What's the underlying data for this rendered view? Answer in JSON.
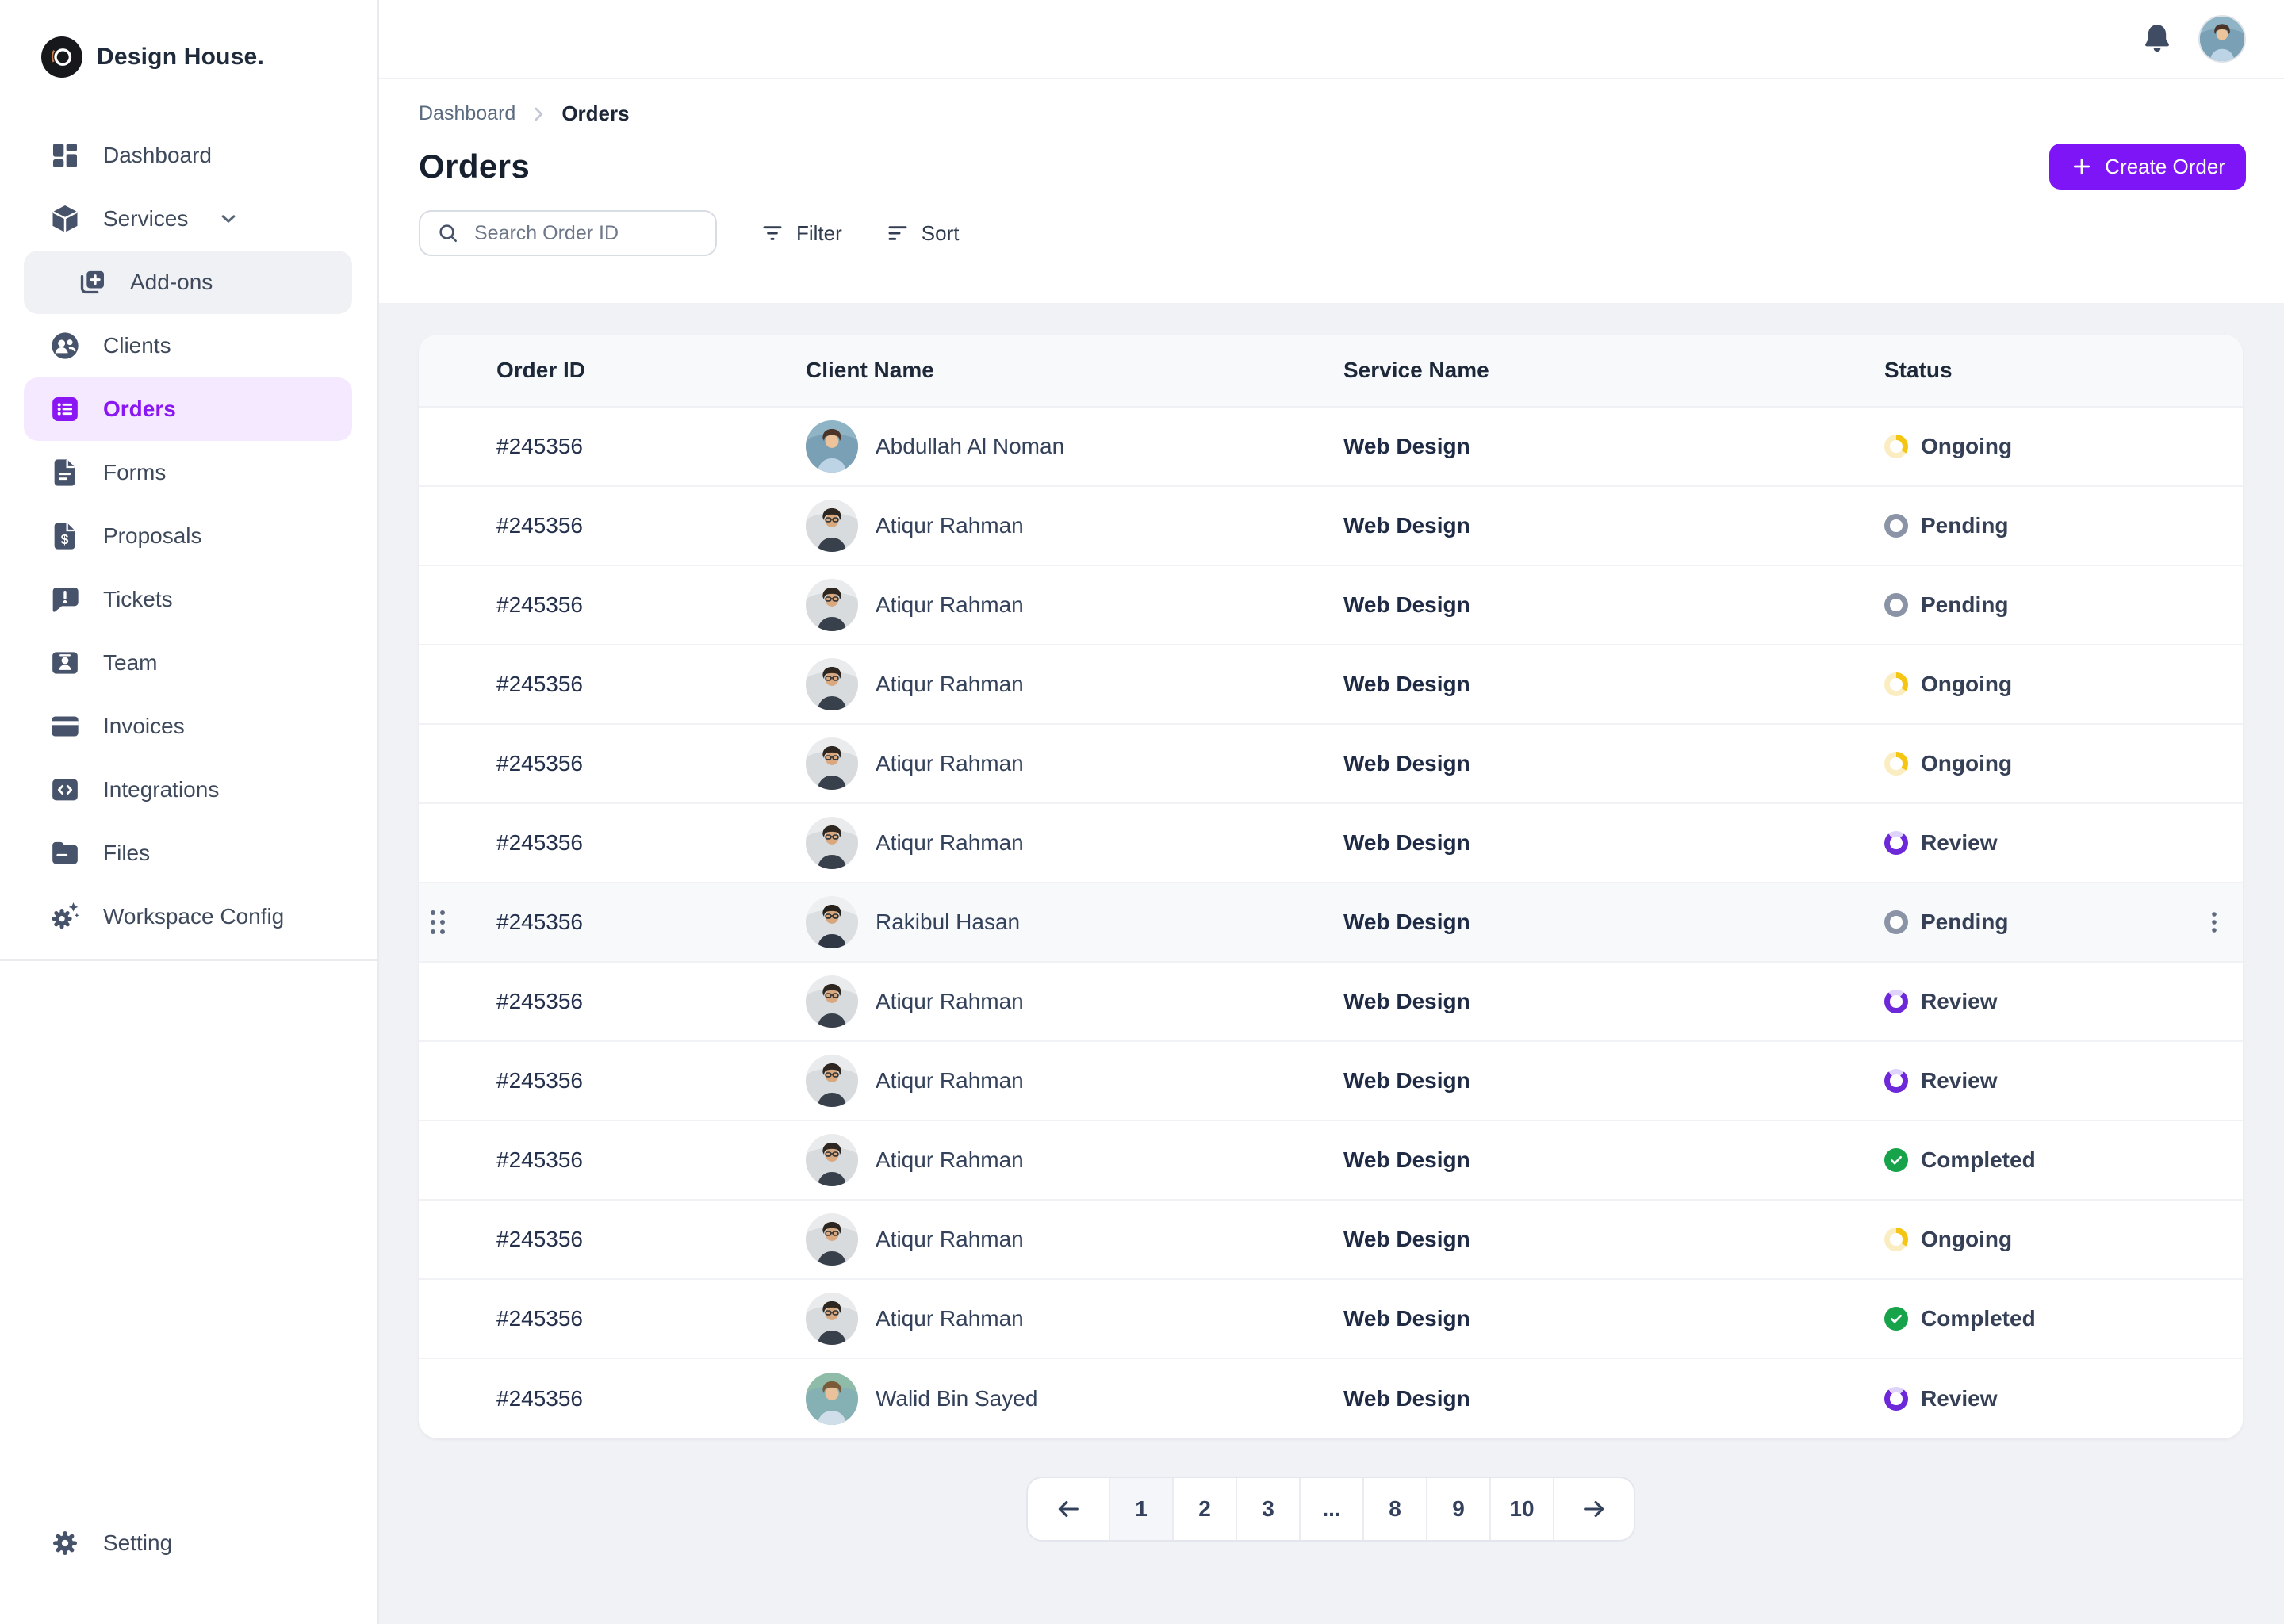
{
  "brand": {
    "name": "Design House.",
    "logo_icon": "brand-logo-icon"
  },
  "accent_color": "#8A16F3",
  "sidebar": {
    "items": [
      {
        "label": "Dashboard",
        "icon": "dashboard-icon"
      },
      {
        "label": "Services",
        "icon": "services-box-icon",
        "chevron": true
      },
      {
        "label": "Add-ons",
        "icon": "copy-plus-icon",
        "sub": true
      },
      {
        "label": "Clients",
        "icon": "clients-users-icon"
      },
      {
        "label": "Orders",
        "icon": "orders-list-icon",
        "active": true
      },
      {
        "label": "Forms",
        "icon": "forms-file-icon"
      },
      {
        "label": "Proposals",
        "icon": "proposals-file-dollar-icon"
      },
      {
        "label": "Tickets",
        "icon": "tickets-chat-alert-icon"
      },
      {
        "label": "Team",
        "icon": "team-id-card-icon"
      },
      {
        "label": "Invoices",
        "icon": "invoices-credit-card-icon"
      },
      {
        "label": "Integrations",
        "icon": "integrations-code-icon"
      },
      {
        "label": "Files",
        "icon": "files-folder-icon"
      },
      {
        "label": "Workspace Config",
        "icon": "workspace-config-gear-sparkle-icon"
      }
    ],
    "footer": {
      "label": "Setting",
      "icon": "gear-icon"
    }
  },
  "topbar": {
    "icons": [
      "bell-icon",
      "user-avatar"
    ]
  },
  "breadcrumb": {
    "parent": "Dashboard",
    "current": "Orders"
  },
  "page": {
    "title": "Orders",
    "create_button": "Create Order"
  },
  "toolbar": {
    "search_placeholder": "Search Order ID",
    "filter_label": "Filter",
    "sort_label": "Sort"
  },
  "table": {
    "columns": [
      "Order ID",
      "Client Name",
      "Service Name",
      "Status"
    ],
    "rows": [
      {
        "order_id": "#245356",
        "client": "Abdullah Al Noman",
        "avatar": "abdullah",
        "service": "Web Design",
        "status": "Ongoing"
      },
      {
        "order_id": "#245356",
        "client": "Atiqur Rahman",
        "avatar": "atiqur",
        "service": "Web Design",
        "status": "Pending"
      },
      {
        "order_id": "#245356",
        "client": "Atiqur Rahman",
        "avatar": "atiqur",
        "service": "Web Design",
        "status": "Pending"
      },
      {
        "order_id": "#245356",
        "client": "Atiqur Rahman",
        "avatar": "atiqur",
        "service": "Web Design",
        "status": "Ongoing"
      },
      {
        "order_id": "#245356",
        "client": "Atiqur Rahman",
        "avatar": "atiqur",
        "service": "Web Design",
        "status": "Ongoing"
      },
      {
        "order_id": "#245356",
        "client": "Atiqur Rahman",
        "avatar": "atiqur",
        "service": "Web Design",
        "status": "Review"
      },
      {
        "order_id": "#245356",
        "client": "Rakibul Hasan",
        "avatar": "rakibul",
        "service": "Web Design",
        "status": "Pending",
        "highlighted": true
      },
      {
        "order_id": "#245356",
        "client": "Atiqur Rahman",
        "avatar": "atiqur",
        "service": "Web Design",
        "status": "Review"
      },
      {
        "order_id": "#245356",
        "client": "Atiqur Rahman",
        "avatar": "atiqur",
        "service": "Web Design",
        "status": "Review"
      },
      {
        "order_id": "#245356",
        "client": "Atiqur Rahman",
        "avatar": "atiqur",
        "service": "Web Design",
        "status": "Completed"
      },
      {
        "order_id": "#245356",
        "client": "Atiqur Rahman",
        "avatar": "atiqur",
        "service": "Web Design",
        "status": "Ongoing"
      },
      {
        "order_id": "#245356",
        "client": "Atiqur Rahman",
        "avatar": "atiqur",
        "service": "Web Design",
        "status": "Completed"
      },
      {
        "order_id": "#245356",
        "client": "Walid Bin Sayed",
        "avatar": "walid",
        "service": "Web Design",
        "status": "Review"
      }
    ]
  },
  "status_colors": {
    "Ongoing": {
      "arc": "#F4C513",
      "track": "#FBEDC2"
    },
    "Pending": {
      "arc": "#8A94A6",
      "track": "#8A94A6"
    },
    "Review": {
      "arc": "#6D28D9",
      "track": "#DFD3FB"
    },
    "Completed": {
      "fill": "#17A34A"
    }
  },
  "avatar_colors": {
    "abdullah": {
      "bg1": "#8FB4C6",
      "bg2": "#678FA6",
      "hair": "#4A3528",
      "skin": "#ECC39B",
      "shirt": "#BCD4E6"
    },
    "atiqur": {
      "bg1": "#E9EBEC",
      "bg2": "#C9CDD1",
      "hair": "#2E2620",
      "skin": "#D9A87E",
      "shirt": "#38404C",
      "glasses": "#3A3A3A"
    },
    "rakibul": {
      "bg1": "#EDEFF0",
      "bg2": "#CDD2D6",
      "hair": "#27211C",
      "skin": "#D6A77D",
      "shirt": "#2F3844",
      "glasses": "#333333"
    },
    "walid": {
      "bg1": "#8FBCA8",
      "bg2": "#7FA8BE",
      "hair": "#7A5A38",
      "skin": "#E9C29B",
      "shirt": "#CFDEE8"
    }
  },
  "pagination": {
    "prev_icon": "arrow-left-icon",
    "next_icon": "arrow-right-icon",
    "pages": [
      "1",
      "2",
      "3",
      "...",
      "8",
      "9",
      "10"
    ],
    "active_page": "1"
  }
}
